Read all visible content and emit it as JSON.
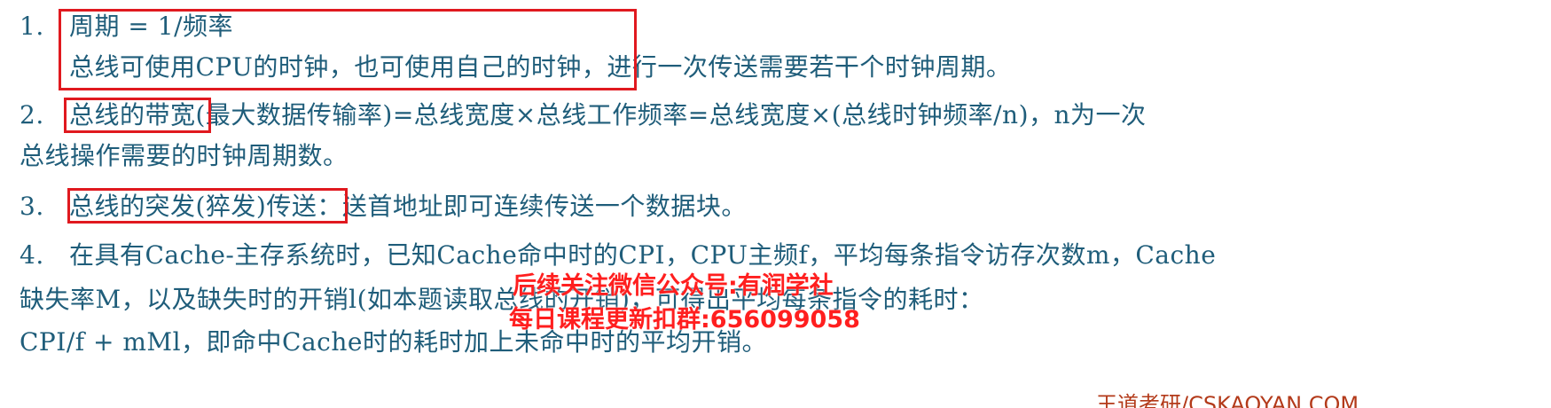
{
  "items": [
    {
      "number": "1.",
      "lines": [
        "周期 = 1/频率",
        "总线可使用CPU的时钟，也可使用自己的时钟，进行一次传送需要若干个时钟周期。"
      ]
    },
    {
      "number": "2.",
      "lines": [
        "总线的带宽(最大数据传输率)=总线宽度×总线工作频率=总线宽度×(总线时钟频率/n)，n为一次",
        "总线操作需要的时钟周期数。"
      ]
    },
    {
      "number": "3.",
      "lines": [
        "总线的突发(猝发)传送：送首地址即可连续传送一个数据块。"
      ]
    },
    {
      "number": "4.",
      "lines": [
        "在具有Cache-主存系统时，已知Cache命中时的CPI，CPU主频f，平均每条指令访存次数m，Cache",
        "缺失率M，以及缺失时的开销l(如本题读取总线的开销)，可得出平均每条指令的耗时：",
        "CPI/f + mMl，即命中Cache时的耗时加上未命中时的平均开销。"
      ]
    }
  ],
  "watermark": {
    "line1": "后续关注微信公众号:有润学社",
    "line2": "每日课程更新扣群:656099058"
  },
  "footer_brand": "王道考研/CSKAOYAN.COM",
  "colors": {
    "text": "#1f5d7a",
    "highlight_box": "#e0191f",
    "watermark": "#ff1f1f"
  }
}
